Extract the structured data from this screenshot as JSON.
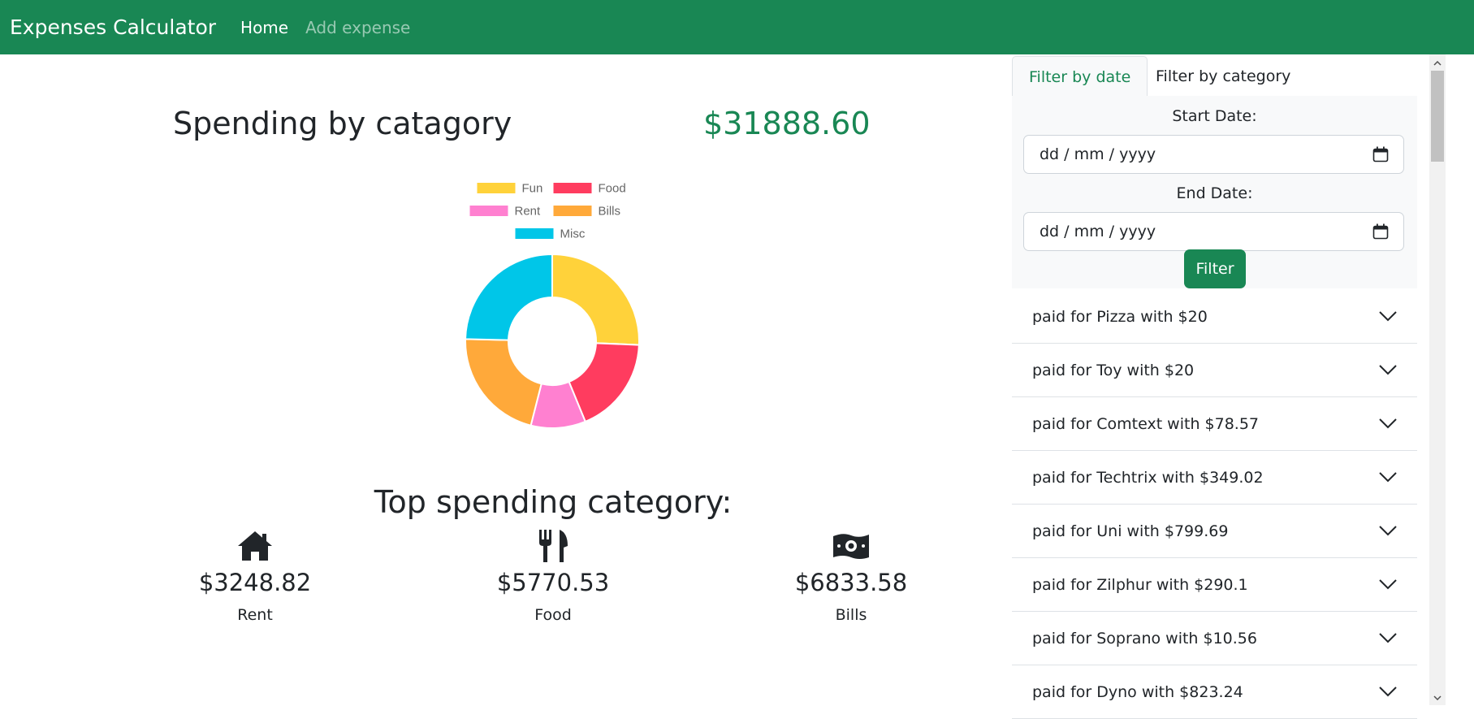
{
  "navbar": {
    "brand": "Expenses Calculator",
    "links": [
      {
        "label": "Home",
        "active": true
      },
      {
        "label": "Add expense",
        "active": false
      }
    ],
    "background": "#198754"
  },
  "summary": {
    "title": "Spending by catagory",
    "total": "$31888.60"
  },
  "chart_data": {
    "type": "pie",
    "donut": true,
    "legend_position": "top",
    "categories": [
      "Fun",
      "Food",
      "Rent",
      "Bills",
      "Misc"
    ],
    "values": [
      8190,
      5771,
      3249,
      6834,
      7845
    ],
    "colors": [
      "#ffd23a",
      "#ff3c5f",
      "#ff80d0",
      "#ffa93a",
      "#00c6e8"
    ]
  },
  "top_spending": {
    "title": "Top spending category:",
    "items": [
      {
        "icon": "house-icon",
        "amount": "$3248.82",
        "label": "Rent"
      },
      {
        "icon": "utensils-icon",
        "amount": "$5770.53",
        "label": "Food"
      },
      {
        "icon": "money-bill-icon",
        "amount": "$6833.58",
        "label": "Bills"
      }
    ]
  },
  "filters": {
    "tabs": [
      {
        "label": "Filter by date",
        "active": true
      },
      {
        "label": "Filter by category",
        "active": false
      }
    ],
    "start_label": "Start Date:",
    "start_value": "dd / mm / yyyy",
    "end_label": "End Date:",
    "end_value": "dd / mm / yyyy",
    "button": "Filter"
  },
  "expenses": [
    "paid for Pizza with $20",
    "paid for Toy with $20",
    "paid for Comtext with $78.57",
    "paid for Techtrix with $349.02",
    "paid for Uni with $799.69",
    "paid for Zilphur with $290.1",
    "paid for Soprano with $10.56",
    "paid for Dyno with $823.24"
  ]
}
